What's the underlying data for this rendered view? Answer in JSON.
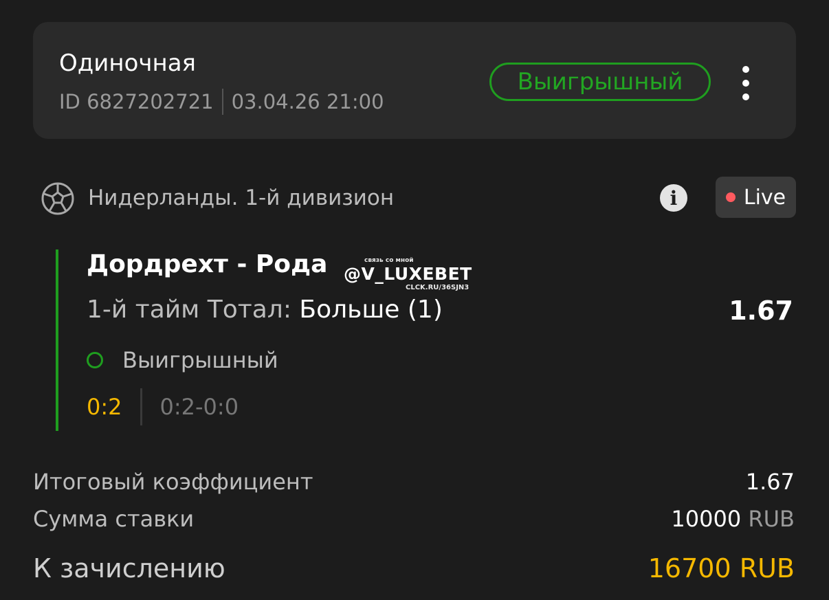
{
  "bet": {
    "type": "Одиночная",
    "id": "ID 6827202721",
    "datetime": "03.04.26 21:00",
    "status": "Выигрышный"
  },
  "league": {
    "name": "Нидерланды. 1-й дивизион",
    "live_label": "Live"
  },
  "event": {
    "title": "Дордрехт - Рода",
    "market_label": "1-й тайм Тотал: ",
    "market_value": "Больше (1)",
    "odds": "1.67",
    "result": "Выигрышный",
    "score": "0:2",
    "score_detail": "0:2-0:0"
  },
  "watermark": {
    "top": "связь со мной",
    "main": "@V_LUXEBET",
    "bottom": "CLCK.RU/36SJN3"
  },
  "summary": {
    "coef_label": "Итоговый коэффициент",
    "coef_value": "1.67",
    "stake_label": "Сумма ставки",
    "stake_amount": "10000",
    "stake_currency": "RUB",
    "payout_label": "К зачислению",
    "payout_value": "16700 RUB"
  },
  "colors": {
    "background": "#1c1c1c",
    "card": "#2a2a2a",
    "win_green": "#1f9e1f",
    "payout_gold": "#f5b800",
    "live_red": "#ff5a5f"
  },
  "icons": [
    "soccer-ball-icon",
    "info-icon",
    "more-vertical-icon",
    "live-dot-icon",
    "result-ring-icon"
  ]
}
